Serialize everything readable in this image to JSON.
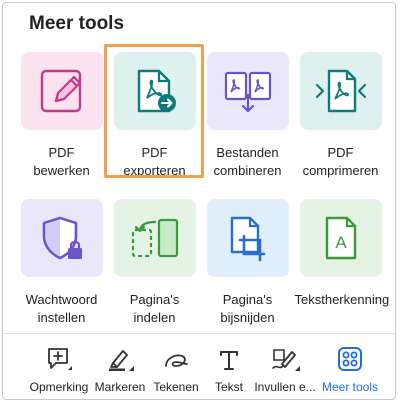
{
  "title": "Meer tools",
  "tools": [
    {
      "label": "PDF\nbewerken",
      "icon": "edit-pdf-icon",
      "color": "#c03a88"
    },
    {
      "label": "PDF\nexporteren",
      "icon": "export-pdf-icon",
      "color": "#0e7a7a",
      "selected": true
    },
    {
      "label": "Bestanden\ncombineren",
      "icon": "combine-files-icon",
      "color": "#6b54c8"
    },
    {
      "label": "PDF\ncomprimeren",
      "icon": "compress-pdf-icon",
      "color": "#0e7a7a"
    },
    {
      "label": "Wachtwoord\ninstellen",
      "icon": "protect-password-icon",
      "color": "#6b54c8"
    },
    {
      "label": "Pagina's\nindelen",
      "icon": "organize-pages-icon",
      "color": "#3a9a3a"
    },
    {
      "label": "Pagina's\nbijsnijden",
      "icon": "crop-pages-icon",
      "color": "#2a6fd0"
    },
    {
      "label": "Tekstherkenning",
      "icon": "text-recognition-icon",
      "color": "#3a9a3a"
    }
  ],
  "toolbar": [
    {
      "label": "Opmerking",
      "icon": "comment-icon"
    },
    {
      "label": "Markeren",
      "icon": "highlight-icon"
    },
    {
      "label": "Tekenen",
      "icon": "draw-icon"
    },
    {
      "label": "Tekst",
      "icon": "text-icon"
    },
    {
      "label": "Invullen e...",
      "icon": "fill-sign-icon"
    },
    {
      "label": "Meer tools",
      "icon": "more-tools-icon",
      "active": true
    }
  ],
  "colors": {
    "accent": "#1f6fd8",
    "selection": "#f0a050"
  }
}
